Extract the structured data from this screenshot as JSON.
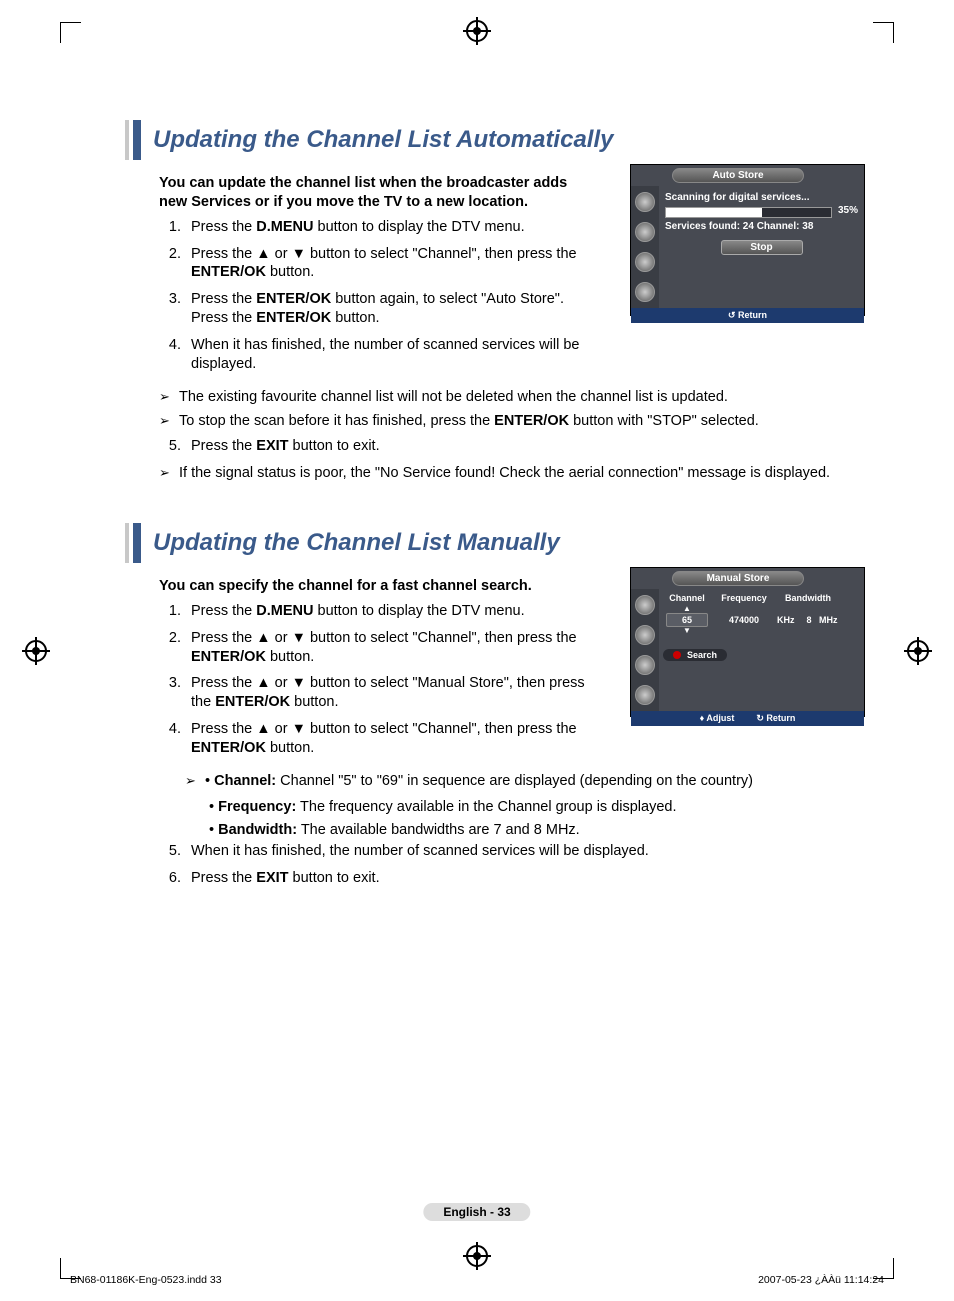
{
  "section1": {
    "title": "Updating the Channel List Automatically",
    "intro": "You can update the channel list when the broadcaster adds new Services or if you move the TV to a new location.",
    "steps": {
      "s1a": "Press the ",
      "s1b": "D.MENU",
      "s1c": " button to display the DTV menu.",
      "s2a": "Press the ▲ or ▼ button to select \"Channel\", then press the ",
      "s2b": "ENTER/OK",
      "s2c": " button.",
      "s3a": "Press the ",
      "s3b": "ENTER/OK",
      "s3c": " button again, to select \"Auto Store\". Press the ",
      "s3d": "ENTER/OK",
      "s3e": " button.",
      "s4": "When it has finished, the number of scanned services will be displayed."
    },
    "notes": {
      "n1": "The existing favourite channel list will not be deleted when the channel list is updated.",
      "n2a": "To stop the scan before it has finished, press the ",
      "n2b": "ENTER/OK",
      "n2c": " button with \"STOP\" selected.",
      "n3": "If the signal status is poor, the \"No Service found! Check the aerial connection\" message is displayed."
    },
    "step5a": "Press the ",
    "step5b": "EXIT",
    "step5c": " button to exit."
  },
  "panel1": {
    "title": "Auto Store",
    "scanning": "Scanning for digital services...",
    "pct": "35%",
    "services": "Services found: 24    Channel: 38",
    "stop": "Stop",
    "return": "Return"
  },
  "section2": {
    "title": "Updating the Channel List Manually",
    "intro": "You can specify the channel for a fast channel search.",
    "steps": {
      "s1a": "Press the ",
      "s1b": "D.MENU",
      "s1c": " button to display the DTV menu.",
      "s2a": "Press the ▲ or ▼ button to select \"Channel\", then press the ",
      "s2b": "ENTER/OK",
      "s2c": " button.",
      "s3a": "Press the ▲ or ▼ button to select \"Manual Store\", then press the ",
      "s3b": "ENTER/OK",
      "s3c": " button.",
      "s4a": "Press the ▲ or ▼ button to select \"Channel\", then press the ",
      "s4b": "ENTER/OK",
      "s4c": " button."
    },
    "sub": {
      "a1": "Channel:",
      "a2": " Channel \"5\" to \"69\" in sequence are displayed (depending on the country)",
      "b1": "Frequency:",
      "b2": " The frequency available in the Channel group is displayed.",
      "c1": "Bandwidth:",
      "c2": " The available bandwidths are 7 and 8 MHz."
    },
    "s5": "When it has finished, the number of scanned services will be displayed.",
    "s6a": "Press the ",
    "s6b": "EXIT",
    "s6c": " button to exit."
  },
  "panel2": {
    "title": "Manual Store",
    "h1": "Channel",
    "h2": "Frequency",
    "h3": "Bandwidth",
    "ch": "65",
    "freq": "474000",
    "khz": "KHz",
    "bw": "8",
    "mhz": "MHz",
    "search": "Search",
    "adjust": "Adjust",
    "return": "Return"
  },
  "pageLabel": "English - 33",
  "footer": {
    "left": "BN68-01186K-Eng-0523.indd   33",
    "right": "2007-05-23   ¿ÀÀü 11:14:24"
  }
}
